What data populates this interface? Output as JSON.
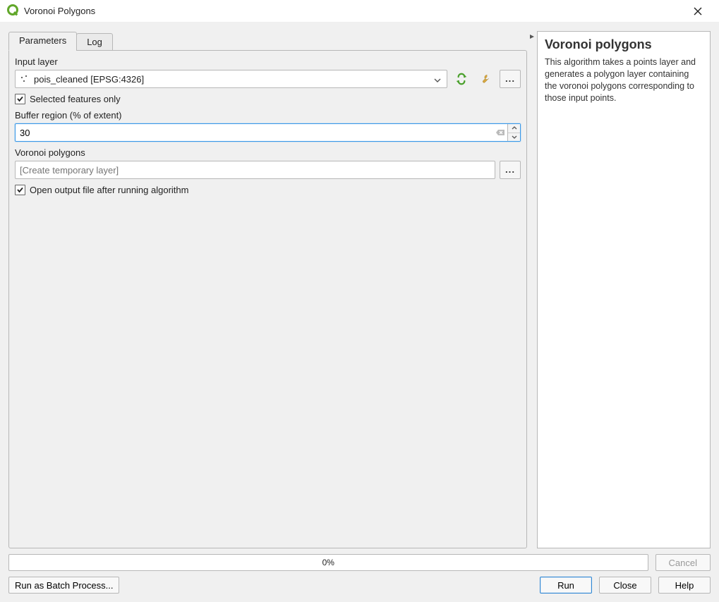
{
  "title": "Voronoi Polygons",
  "tabs": {
    "parameters": "Parameters",
    "log": "Log"
  },
  "form": {
    "input_layer_label": "Input layer",
    "input_layer_value": "pois_cleaned [EPSG:4326]",
    "selected_features_label": "Selected features only",
    "selected_features_checked": true,
    "buffer_label": "Buffer region (% of extent)",
    "buffer_value": "30",
    "output_label": "Voronoi polygons",
    "output_placeholder": "[Create temporary layer]",
    "open_after_label": "Open output file after running algorithm",
    "open_after_checked": true
  },
  "help": {
    "title": "Voronoi polygons",
    "body": "This algorithm takes a points layer and generates a polygon layer containing the voronoi polygons corresponding to those input points."
  },
  "progress": "0%",
  "buttons": {
    "cancel": "Cancel",
    "batch": "Run as Batch Process...",
    "run": "Run",
    "close": "Close",
    "help": "Help"
  }
}
